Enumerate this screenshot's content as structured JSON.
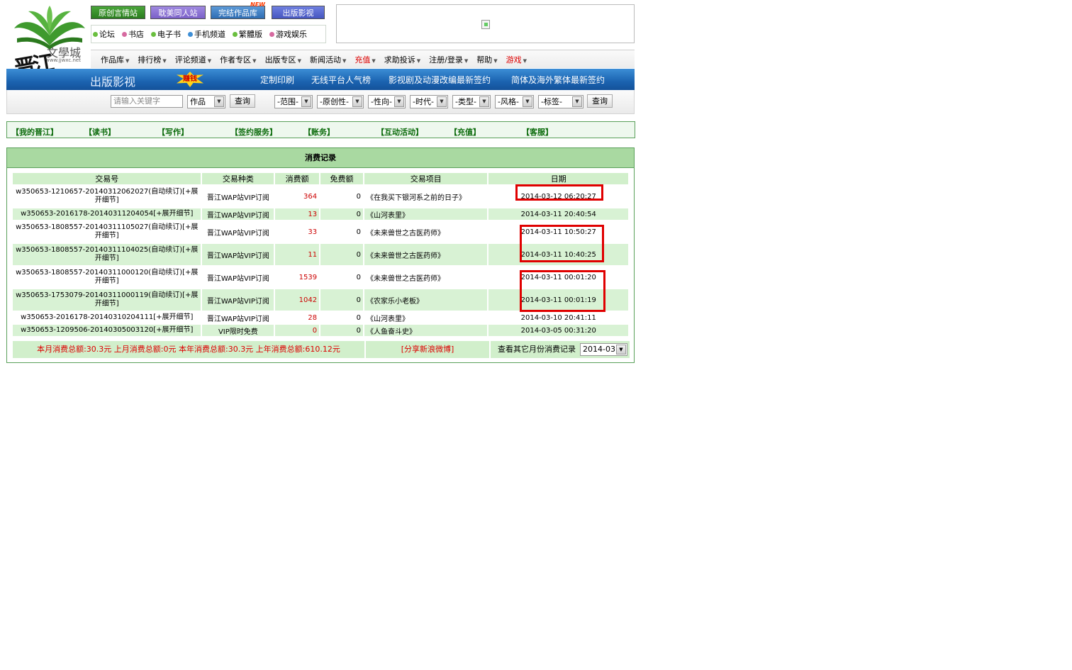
{
  "logo": {
    "site_name": "文學城",
    "site_url": "www.jjwxc.net",
    "calligraphy": "晋江"
  },
  "top_buttons": [
    {
      "label": "原创言情站",
      "style": "green"
    },
    {
      "label": "耽美同人站",
      "style": "purple"
    },
    {
      "label": "完结作品库",
      "style": "blue"
    },
    {
      "label": "出版影视",
      "style": "indigo"
    }
  ],
  "new_badge": "NEW",
  "quick_links": [
    {
      "label": "论坛",
      "color": "#6abf3f"
    },
    {
      "label": "书店",
      "color": "#d66aa0"
    },
    {
      "label": "电子书",
      "color": "#6abf3f"
    },
    {
      "label": "手机频道",
      "color": "#3f8fd6"
    },
    {
      "label": "繁體版",
      "color": "#6abf3f"
    },
    {
      "label": "游戏娱乐",
      "color": "#d66aa0"
    }
  ],
  "nav": [
    {
      "label": "作品库",
      "red": false
    },
    {
      "label": "排行榜",
      "red": false
    },
    {
      "label": "评论频道",
      "red": false
    },
    {
      "label": "作者专区",
      "red": false
    },
    {
      "label": "出版专区",
      "red": false
    },
    {
      "label": "新闻活动",
      "red": false
    },
    {
      "label": "充值",
      "red": true
    },
    {
      "label": "求助投诉",
      "red": false
    },
    {
      "label": "注册/登录",
      "red": false
    },
    {
      "label": "帮助",
      "red": false
    },
    {
      "label": "游戏",
      "red": true
    }
  ],
  "bluebar": {
    "section": "出版影视",
    "tag": "赚钱",
    "links": [
      "定制印刷",
      "无线平台人气榜",
      "影视剧及动漫改编最新签约",
      "简体及海外繁体最新签约"
    ]
  },
  "search": {
    "placeholder": "请输入关键字",
    "type": "作品",
    "submit": "查询",
    "filters": [
      "-范围-",
      "-原创性-",
      "-性向-",
      "-时代-",
      "-类型-",
      "-风格-",
      "-标签-"
    ],
    "submit2": "查询"
  },
  "menu": [
    "【我的晋江】",
    "【读书】",
    "【写作】",
    "【签约服务】",
    "【账务】",
    "【互动活动】",
    "【充值】",
    "【客服】"
  ],
  "records": {
    "caption": "消费记录",
    "headers": [
      "交易号",
      "交易种类",
      "消费额",
      "免费额",
      "交易项目",
      "日期"
    ],
    "rows": [
      {
        "id": "w350653-1210657-20140312062027(自动续订)[+展开细节]",
        "type": "晋江WAP站VIP订阅",
        "amount": "364",
        "free": "0",
        "item": "《在我买下银河系之前的日子》",
        "date": "2014-03-12 06:20:27"
      },
      {
        "id": "w350653-2016178-20140311204054[+展开细节]",
        "type": "晋江WAP站VIP订阅",
        "amount": "13",
        "free": "0",
        "item": "《山河表里》",
        "date": "2014-03-11 20:40:54"
      },
      {
        "id": "w350653-1808557-20140311105027(自动续订)[+展开细节]",
        "type": "晋江WAP站VIP订阅",
        "amount": "33",
        "free": "0",
        "item": "《未来兽世之古医药师》",
        "date": "2014-03-11 10:50:27"
      },
      {
        "id": "w350653-1808557-20140311104025(自动续订)[+展开细节]",
        "type": "晋江WAP站VIP订阅",
        "amount": "11",
        "free": "0",
        "item": "《未来兽世之古医药师》",
        "date": "2014-03-11 10:40:25"
      },
      {
        "id": "w350653-1808557-20140311000120(自动续订)[+展开细节]",
        "type": "晋江WAP站VIP订阅",
        "amount": "1539",
        "free": "0",
        "item": "《未来兽世之古医药师》",
        "date": "2014-03-11 00:01:20"
      },
      {
        "id": "w350653-1753079-20140311000119(自动续订)[+展开细节]",
        "type": "晋江WAP站VIP订阅",
        "amount": "1042",
        "free": "0",
        "item": "《农家乐小老板》",
        "date": "2014-03-11 00:01:19"
      },
      {
        "id": "w350653-2016178-20140310204111[+展开细节]",
        "type": "晋江WAP站VIP订阅",
        "amount": "28",
        "free": "0",
        "item": "《山河表里》",
        "date": "2014-03-10 20:41:11"
      },
      {
        "id": "w350653-1209506-20140305003120[+展开细节]",
        "type": "VIP限时免费",
        "amount": "0",
        "free": "0",
        "item": "《人鱼奋斗史》",
        "date": "2014-03-05 00:31:20"
      }
    ],
    "summary": {
      "totals": "本月消费总额:30.3元  上月消费总额:0元  本年消费总额:30.3元  上年消费总额:610.12元",
      "share": "[分享新浪微博]",
      "month_label": "查看其它月份消费记录",
      "month_value": "2014-03"
    }
  },
  "annotation_color": "#e00000"
}
